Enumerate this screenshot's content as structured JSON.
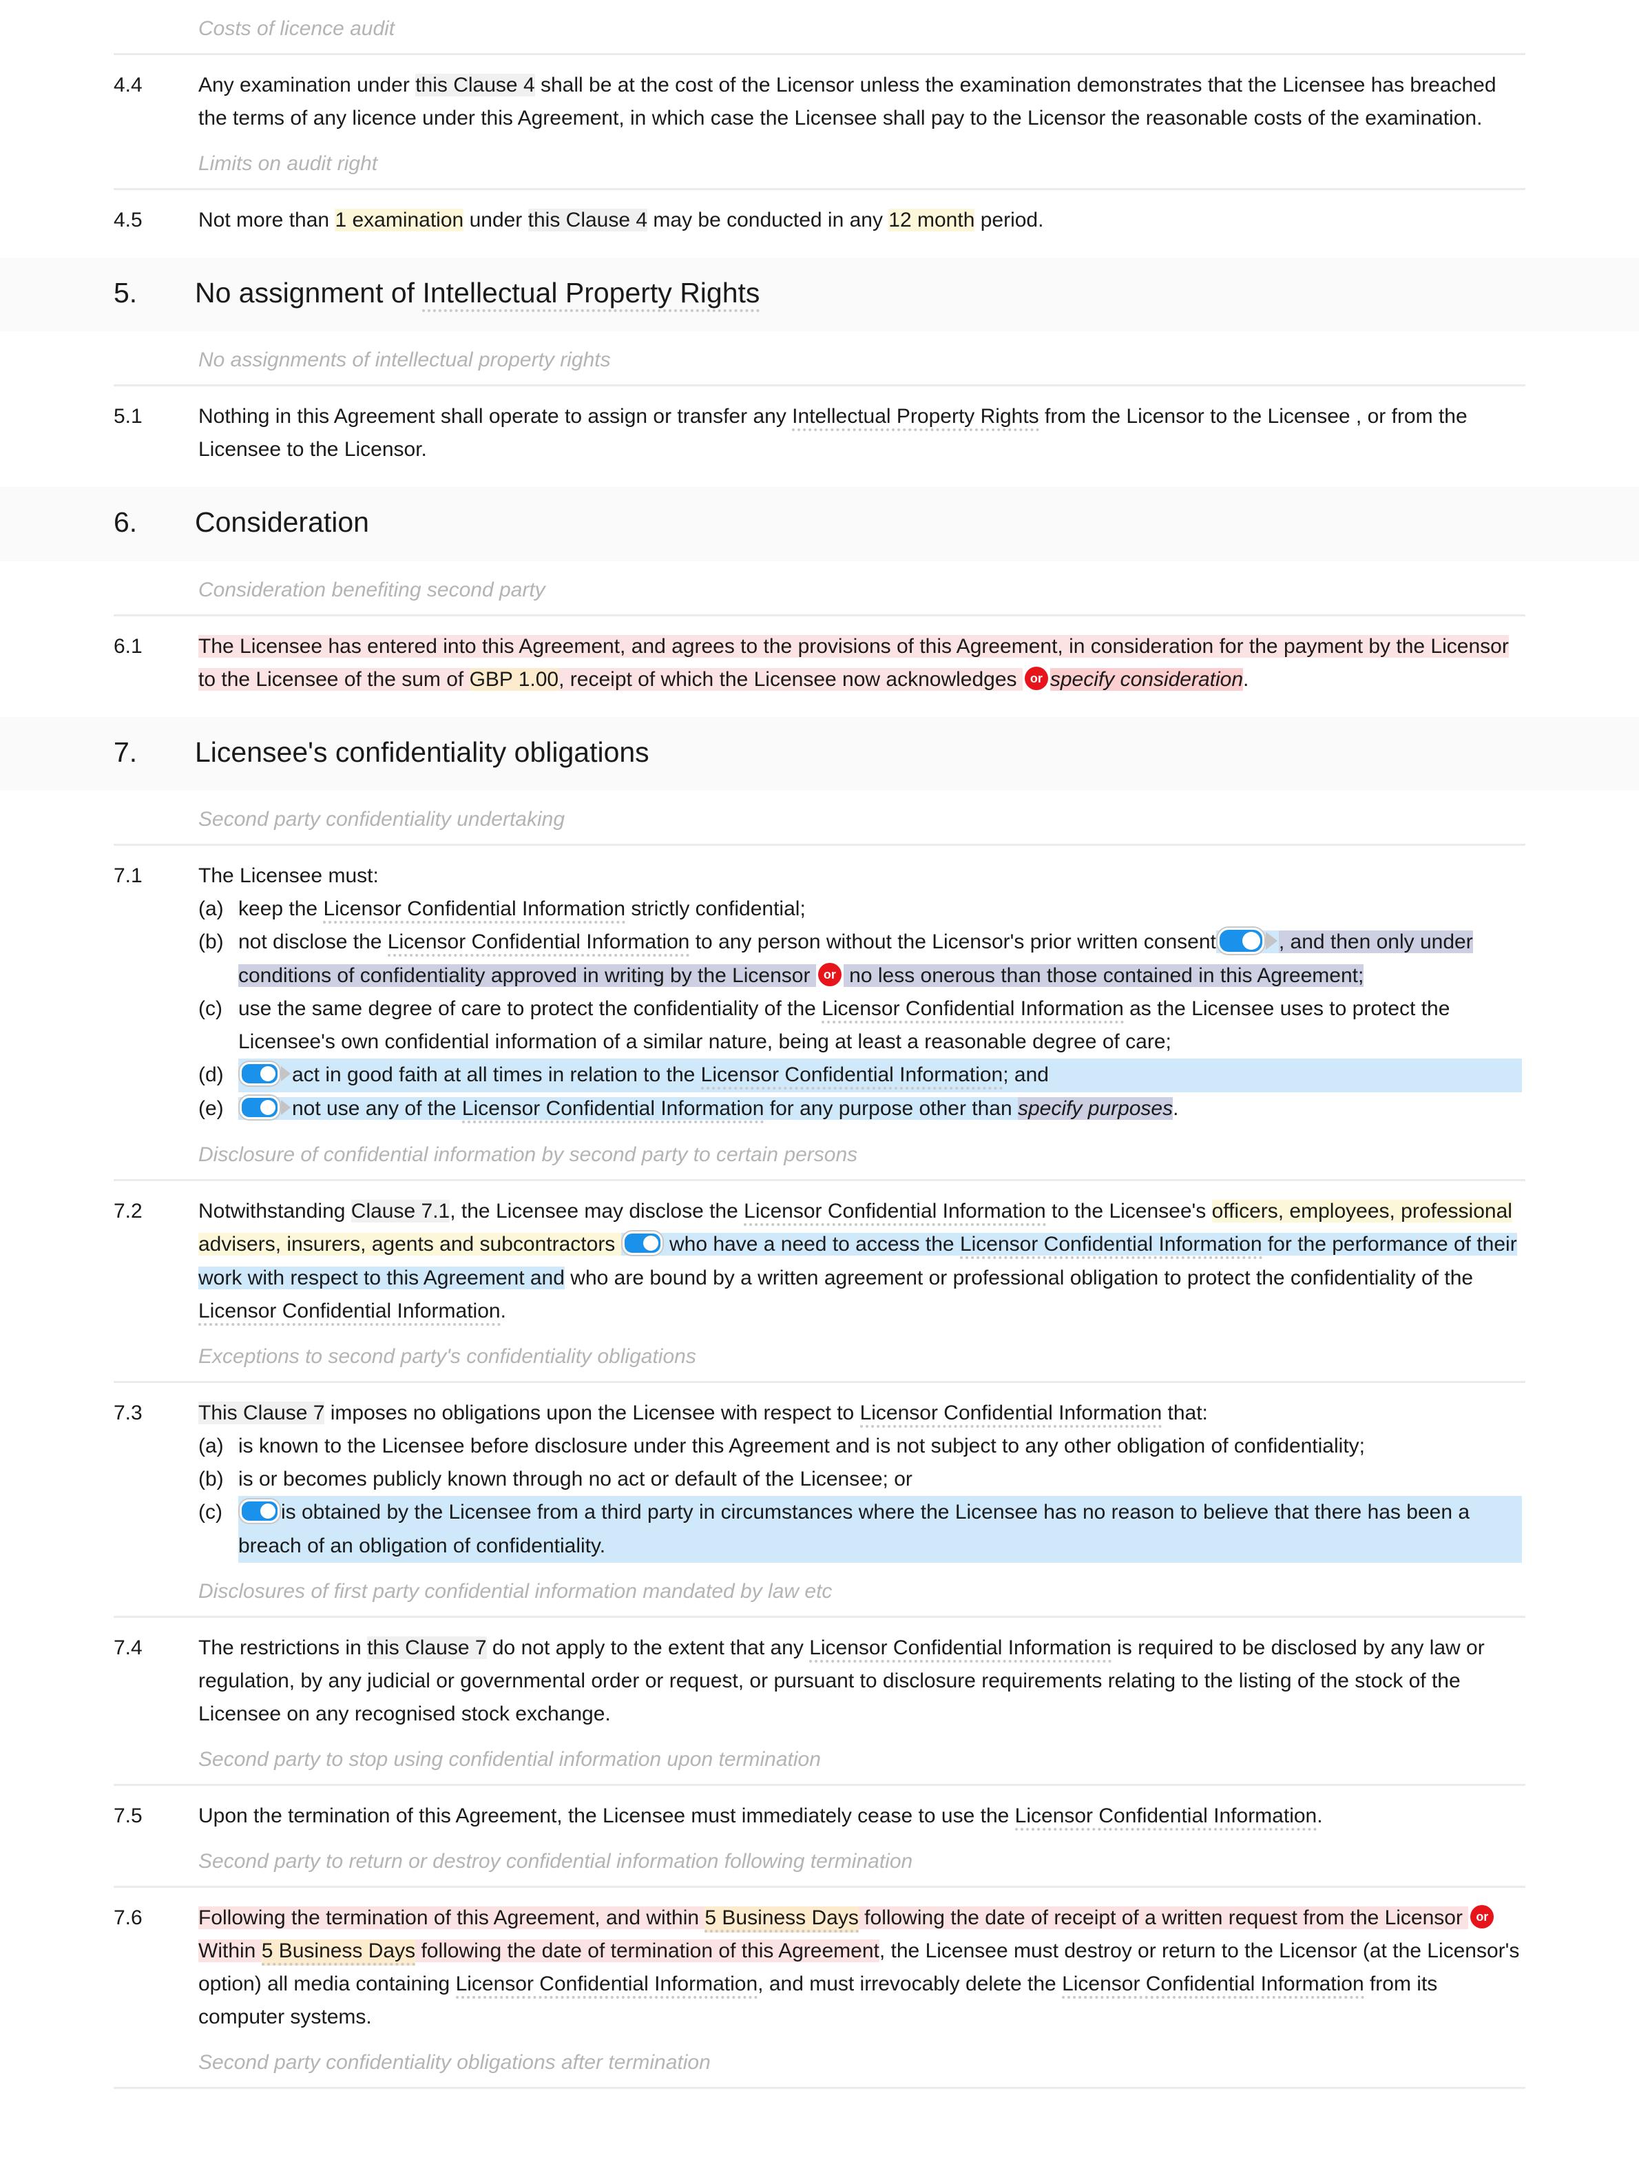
{
  "document": {
    "type": "licence agreement",
    "colors": {
      "badge_or": "#e8141b",
      "toggle_on": "#1a91eb",
      "highlight_grey": "#f0f0f0",
      "highlight_yellow": "#fbf7d8",
      "highlight_blue": "#cfe8fa",
      "highlight_lavender": "#cdd0e3",
      "highlight_pink": "#fbe3e3",
      "highlight_orange": "#fdebcd",
      "rubric_text": "#b4b4b4",
      "section_band": "#fafafa"
    }
  },
  "rubrics": {
    "costs_of_licence_audit": "Costs of licence audit",
    "limits_on_audit_right": "Limits on audit right",
    "no_assignments_ipr": "No assignments of intellectual property rights",
    "consideration_benefiting": "Consideration benefiting second party",
    "second_party_undertaking": "Second party confidentiality undertaking",
    "disclosure_certain_persons": "Disclosure of confidential information by second party to certain persons",
    "exceptions_obligations": "Exceptions to second party's confidentiality obligations",
    "disclosures_mandated": "Disclosures of first party confidential information mandated by law etc",
    "stop_using_upon_termination": "Second party to stop using confidential information upon termination",
    "return_or_destroy": "Second party to return or destroy confidential information following termination",
    "obligations_after_termination": "Second party confidentiality obligations after termination"
  },
  "sections": {
    "s5": {
      "number": "5.",
      "title_a": "No assignment of ",
      "title_term": "Intellectual Property Rights"
    },
    "s6": {
      "number": "6.",
      "title": "Consideration"
    },
    "s7": {
      "number": "7.",
      "title": "Licensee's confidentiality obligations"
    }
  },
  "clauses": {
    "c44": {
      "number": "4.4",
      "t1": "Any examination under ",
      "ref": "this Clause 4",
      "t2": " shall be at the cost of the Licensor unless the examination demonstrates that the Licensee has breached the terms of any licence under this Agreement, in which case the Licensee shall pay to the Licensor the reasonable costs of the examination."
    },
    "c45": {
      "number": "4.5",
      "t1": "Not more than ",
      "var1": "1 examination",
      "t2": " under ",
      "ref": "this Clause 4",
      "t3": " may be conducted in any ",
      "var2": "12 month",
      "t4": " period."
    },
    "c51": {
      "number": "5.1",
      "t1": "Nothing in this Agreement shall operate to assign or transfer any ",
      "term": "Intellectual Property Rights",
      "t2": " from the Licensor to the Licensee , or from the Licensee to the Licensor."
    },
    "c61": {
      "number": "6.1",
      "t1": "The Licensee has entered into this Agreement, and agrees to the provisions of this Agreement, in consideration for the",
      "t2": "payment by the Licensor to the Licensee of the sum of ",
      "amount": "GBP 1.00",
      "t3": ", receipt of which the Licensee now acknowledges ",
      "or": "or",
      "placeholder": "specify consideration",
      "t4": "."
    },
    "c71": {
      "number": "7.1",
      "lead": "The Licensee must:",
      "items": [
        {
          "mark": "(a)",
          "t1": "keep the ",
          "term": "Licensor Confidential Information",
          "t2": " strictly confidential;"
        },
        {
          "mark": "(b)",
          "t1": "not disclose the ",
          "term": "Licensor Confidential Information",
          "t2": " to any person without the Licensor's prior written consent",
          "toggle": "toggle-switch-on",
          "t3": ", and then only under conditions of confidentiality approved in writing by the Licensor ",
          "or": "or",
          "t4": " no less onerous than those contained in this Agreement;"
        },
        {
          "mark": "(c)",
          "t1": "use the same degree of care to protect the confidentiality of the ",
          "term": "Licensor Confidential Information",
          "t2": " as the Licensee uses to protect the Licensee's own confidential information of a similar nature, being at least a reasonable degree of care;"
        },
        {
          "mark": "(d)",
          "toggle": "toggle-switch-on",
          "t1": "act in good faith at all times in relation to the ",
          "term": "Licensor Confidential Information",
          "t2": "; and"
        },
        {
          "mark": "(e)",
          "toggle": "toggle-switch-on",
          "t1": "not use any of the ",
          "term": "Licensor Confidential Information",
          "t2": " for any purpose other than ",
          "placeholder": "specify purposes",
          "t3": "."
        }
      ]
    },
    "c72": {
      "number": "7.2",
      "t1": "Notwithstanding ",
      "ref": "Clause 7.1",
      "t2": ", the Licensee may disclose the ",
      "term1": "Licensor Confidential Information",
      "t3": " to the Licensee's ",
      "hl1": "officers, employees, professional advisers, insurers, agents and subcontractors ",
      "toggle": "toggle-switch-on",
      "hl2a": " who have a need to access the ",
      "term2": "Licensor Confidential Information",
      "hl2b": " for the performance of their work with respect to this Agreement and",
      "t4": " who are bound by a written agreement or professional obligation to protect the confidentiality of the ",
      "term3": "Licensor Confidential Information",
      "t5": "."
    },
    "c73": {
      "number": "7.3",
      "ref": "This Clause 7",
      "lead2": " imposes no obligations upon the Licensee with respect to ",
      "term": "Licensor Confidential Information",
      "lead3": " that:",
      "items": [
        {
          "mark": "(a)",
          "t1": "is known to the Licensee before disclosure under this Agreement and is not subject to any other obligation of confidentiality;"
        },
        {
          "mark": "(b)",
          "t1": "is or becomes publicly known through no act or default of the Licensee; or"
        },
        {
          "mark": "(c)",
          "toggle": "toggle-switch-on",
          "t1": "is obtained by the Licensee from a third party in circumstances where the Licensee has no reason to believe that there has been a breach of an obligation of confidentiality."
        }
      ]
    },
    "c74": {
      "number": "7.4",
      "t1": "The restrictions in ",
      "ref": "this Clause 7",
      "t2": " do not apply to the extent that any ",
      "term": "Licensor Confidential Information",
      "t3": " is required to be disclosed by any law or regulation, by any judicial or governmental order or request, or pursuant to disclosure requirements relating to the listing of the stock of the Licensee on any recognised stock exchange."
    },
    "c75": {
      "number": "7.5",
      "t1": "Upon the termination of this Agreement, the Licensee must immediately cease to use the ",
      "term": "Licensor Confidential Information",
      "t2": "."
    },
    "c76": {
      "number": "7.6",
      "t1": "Following the termination of this Agreement, and within ",
      "var1": "5 Business Days",
      "t2": " following the date of receipt of a written request from the Licensor ",
      "or": "or",
      "t3": " Within ",
      "var2": "5 Business Days",
      "t4": " following the date of termination of this Agreement",
      "t5": ", the Licensee must destroy or return to the Licensor (at the Licensor's option) all media containing ",
      "term1": "Licensor Confidential Information",
      "t6": ", and must irrevocably delete the ",
      "term2": "Licensor Confidential Information",
      "t7": " from its computer systems."
    }
  }
}
